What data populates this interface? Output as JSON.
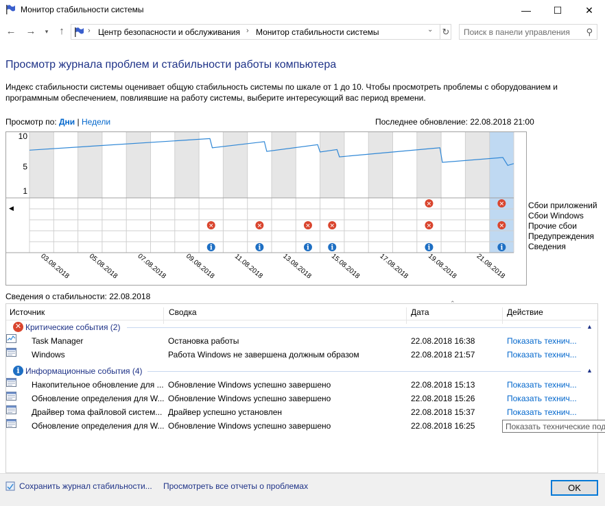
{
  "window": {
    "title": "Монитор стабильности системы",
    "min": "—",
    "max": "☐",
    "close": "✕"
  },
  "nav": {
    "crumbs": [
      "Центр безопасности и обслуживания",
      "Монитор стабильности системы"
    ],
    "search_placeholder": "Поиск в панели управления"
  },
  "page": {
    "title": "Просмотр журнала проблем и стабильности работы компьютера",
    "description": "Индекс стабильности системы оценивает общую стабильность системы по шкале от 1 до 10. Чтобы просмотреть проблемы с оборудованием и программным обеспечением, повлиявшие на работу системы, выберите интересующий вас период времени.",
    "view_by_label": "Просмотр по:",
    "view_days": "Дни",
    "view_sep": "|",
    "view_weeks": "Недели",
    "last_update": "Последнее обновление: 22.08.2018 21:00"
  },
  "chart_data": {
    "type": "line",
    "y_ticks": [
      "10",
      "5",
      "1"
    ],
    "ylim": [
      1,
      10
    ],
    "x_ticks": [
      "03.08.2018",
      "05.08.2018",
      "07.08.2018",
      "09.08.2018",
      "11.08.2018",
      "13.08.2018",
      "15.08.2018",
      "17.08.2018",
      "19.08.2018",
      "21.08.2018"
    ],
    "day_count": 20,
    "selected_day": 19,
    "stability_points": [
      [
        0,
        7.6
      ],
      [
        7.45,
        9.5
      ],
      [
        7.55,
        8.0
      ],
      [
        9.7,
        9.0
      ],
      [
        9.8,
        7.4
      ],
      [
        11.9,
        8.5
      ],
      [
        12.0,
        7.3
      ],
      [
        12.7,
        7.7
      ],
      [
        12.8,
        6.5
      ],
      [
        16.95,
        8.0
      ],
      [
        17.05,
        5.6
      ],
      [
        19.55,
        6.4
      ],
      [
        19.75,
        5.1
      ],
      [
        20.0,
        5.4
      ]
    ],
    "event_rows": [
      "Сбои приложений",
      "Сбои Windows",
      "Прочие сбои",
      "Предупреждения",
      "Сведения"
    ],
    "events": [
      {
        "row": 0,
        "day": 16.5,
        "kind": "error"
      },
      {
        "row": 0,
        "day": 19.5,
        "kind": "error"
      },
      {
        "row": 2,
        "day": 7.5,
        "kind": "error"
      },
      {
        "row": 2,
        "day": 9.5,
        "kind": "error"
      },
      {
        "row": 2,
        "day": 11.5,
        "kind": "error"
      },
      {
        "row": 2,
        "day": 12.5,
        "kind": "error"
      },
      {
        "row": 2,
        "day": 16.5,
        "kind": "error"
      },
      {
        "row": 2,
        "day": 19.5,
        "kind": "error"
      },
      {
        "row": 4,
        "day": 7.5,
        "kind": "info"
      },
      {
        "row": 4,
        "day": 9.5,
        "kind": "info"
      },
      {
        "row": 4,
        "day": 11.5,
        "kind": "info"
      },
      {
        "row": 4,
        "day": 12.5,
        "kind": "info"
      },
      {
        "row": 4,
        "day": 16.5,
        "kind": "info"
      },
      {
        "row": 4,
        "day": 19.5,
        "kind": "info"
      }
    ],
    "colors": {
      "line": "#2f87d6",
      "grey_band": "#e6e6e6",
      "selected": "#bfd9f2",
      "error": "#d9452e",
      "info": "#1e6fc3"
    }
  },
  "details": {
    "title": "Сведения о стабильности: 22.08.2018",
    "columns": [
      "Источник",
      "Сводка",
      "Дата",
      "Действие"
    ],
    "groups": [
      {
        "label": "Критические события (2)",
        "icon": "error-icon",
        "rows": [
          {
            "source": "Task Manager",
            "summary": "Остановка работы",
            "date": "22.08.2018 16:38",
            "action": "Показать технич..."
          },
          {
            "source": "Windows",
            "summary": "Работа Windows не завершена должным образом",
            "date": "22.08.2018 21:57",
            "action": "Показать технич..."
          }
        ]
      },
      {
        "label": "Информационные события (4)",
        "icon": "info-icon",
        "rows": [
          {
            "source": "Накопительное обновление для ...",
            "summary": "Обновление Windows успешно завершено",
            "date": "22.08.2018 15:13",
            "action": "Показать технич..."
          },
          {
            "source": "Обновление определения для W...",
            "summary": "Обновление Windows успешно завершено",
            "date": "22.08.2018 15:26",
            "action": "Показать технич..."
          },
          {
            "source": "Драйвер тома файловой систем...",
            "summary": "Драйвер успешно установлен",
            "date": "22.08.2018 15:37",
            "action": "Показать технич..."
          },
          {
            "source": "Обновление определения для W...",
            "summary": "Обновление Windows успешно завершено",
            "date": "22.08.2018 16:25",
            "action": ""
          }
        ]
      }
    ],
    "tooltip": "Показать технические под"
  },
  "footer": {
    "save_link": "Сохранить журнал стабильности...",
    "reports_link": "Просмотреть все отчеты о проблемах",
    "ok": "OK"
  }
}
